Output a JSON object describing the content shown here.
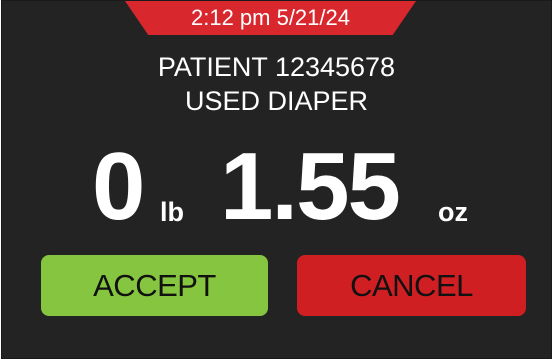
{
  "header": {
    "timestamp": "2:12 pm 5/21/24"
  },
  "patient": {
    "id_label": "PATIENT 12345678",
    "item": "USED DIAPER"
  },
  "weight": {
    "pounds": "0",
    "pounds_unit": "lb",
    "ounces": "1.55",
    "ounces_unit": "oz"
  },
  "actions": {
    "accept_label": "ACCEPT",
    "cancel_label": "CANCEL"
  },
  "colors": {
    "background": "#232323",
    "header_tab": "#d9272e",
    "accept": "#86c540",
    "cancel": "#cf1f23"
  }
}
